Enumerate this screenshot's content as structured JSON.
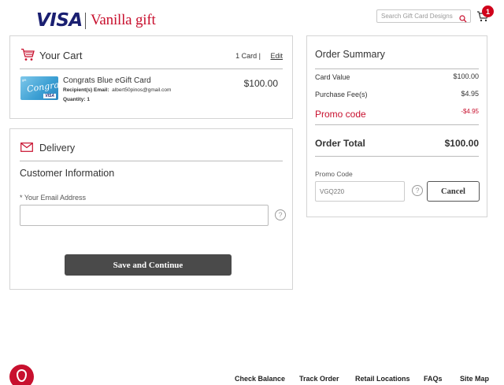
{
  "header": {
    "brand_visa": "VISA",
    "brand_vanilla": "Vanilla gift",
    "search_placeholder": "Search Gift Card Designs",
    "cart_badge": "1"
  },
  "cart": {
    "title": "Your Cart",
    "count": "1 Card |",
    "edit": "Edit",
    "item": {
      "name": "Congrats Blue eGift Card",
      "card_script": "Congrats!",
      "recipient_label": "Recipient(s) Email:",
      "recipient_email": "albert50pinos@gmail.com",
      "quantity": "Quantity: 1",
      "price": "$100.00"
    }
  },
  "delivery": {
    "title": "Delivery",
    "customer_info": "Customer Information",
    "email_label": "* Your Email Address",
    "email_value": "",
    "save_button": "Save and Continue"
  },
  "summary": {
    "title": "Order Summary",
    "card_value_label": "Card Value",
    "card_value": "$100.00",
    "purchase_fee_label": "Purchase Fee(s)",
    "purchase_fee": "$4.95",
    "promo_label": "Promo code",
    "promo_value": "-$4.95",
    "order_total_label": "Order Total",
    "order_total": "$100.00",
    "promo_code_label": "Promo Code",
    "promo_code_placeholder": "VGQ220",
    "cancel_button": "Cancel"
  },
  "footer": {
    "links": [
      "Check Balance",
      "Track Order",
      "Retail Locations",
      "FAQs",
      "Site Map"
    ]
  },
  "colors": {
    "brand_red": "#c8102e",
    "visa_blue": "#1a1f71",
    "button_dark": "#4a4a4a"
  }
}
